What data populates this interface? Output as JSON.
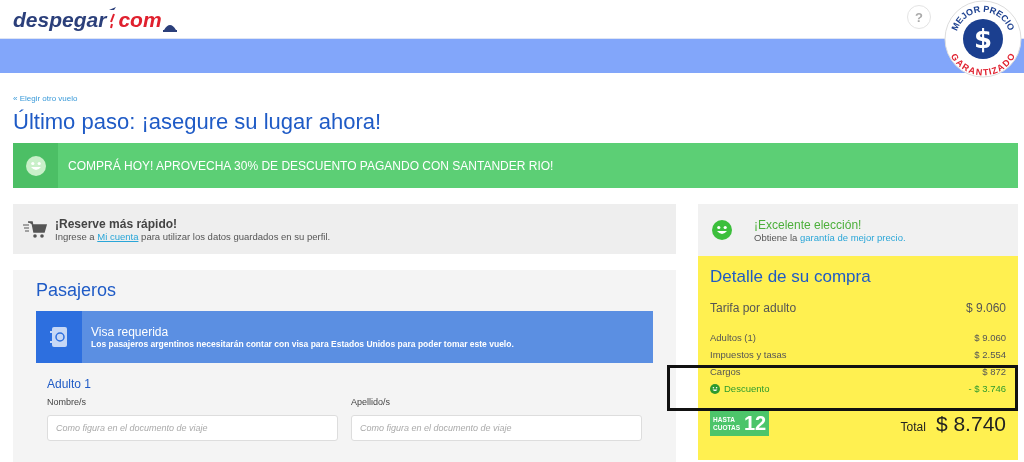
{
  "header": {
    "logo": {
      "word": "despegar",
      "suffix": "com"
    },
    "help": "?",
    "badge": {
      "top": "MEJOR PRECIO",
      "symbol": "$",
      "bottom": "GARANTIZADO"
    }
  },
  "breadcrumb": "« Elegir otro vuelo",
  "title": "Último paso: ¡asegure su lugar ahora!",
  "promo": "COMPRÁ HOY! APROVECHA 30% DE DESCUENTO PAGANDO CON SANTANDER RIO!",
  "reserve": {
    "title": "¡Reserve más rápido!",
    "before": "Ingrese a",
    "link": "Mi cuenta",
    "after": "para utilizar los datos guardados en su perfil."
  },
  "passengers": {
    "title": "Pasajeros",
    "visa": {
      "title": "Visa requerida",
      "text": "Los pasajeros argentinos necesitarán contar con visa para Estados Unidos para poder tomar este vuelo."
    },
    "adult": "Adulto 1",
    "fields": [
      {
        "label": "Nombre/s",
        "placeholder": "Como figura en el documento de viaje"
      },
      {
        "label": "Apellido/s",
        "placeholder": "Como figura en el documento de viaje"
      }
    ]
  },
  "guarantee": {
    "title": "¡Excelente elección!",
    "before": "Obtiene la",
    "link": "garantía de mejor precio."
  },
  "summary": {
    "title": "Detalle de su compra",
    "fare": {
      "label": "Tarifa por adulto",
      "value": "$ 9.060"
    },
    "lines": [
      {
        "kind": "plain",
        "label": "Adultos (1)",
        "value": "$ 9.060"
      },
      {
        "kind": "plain",
        "label": "Impuestos y tasas",
        "value": "$ 2.554"
      },
      {
        "kind": "plain",
        "label": "Cargos",
        "value": "$ 872"
      },
      {
        "kind": "discount",
        "label": "Descuento",
        "value": "- $ 3.746"
      }
    ],
    "installments": {
      "top": "HASTA",
      "bottom": "CUOTAS",
      "number": "12"
    },
    "total_label": "Total",
    "total": "$ 8.740"
  }
}
